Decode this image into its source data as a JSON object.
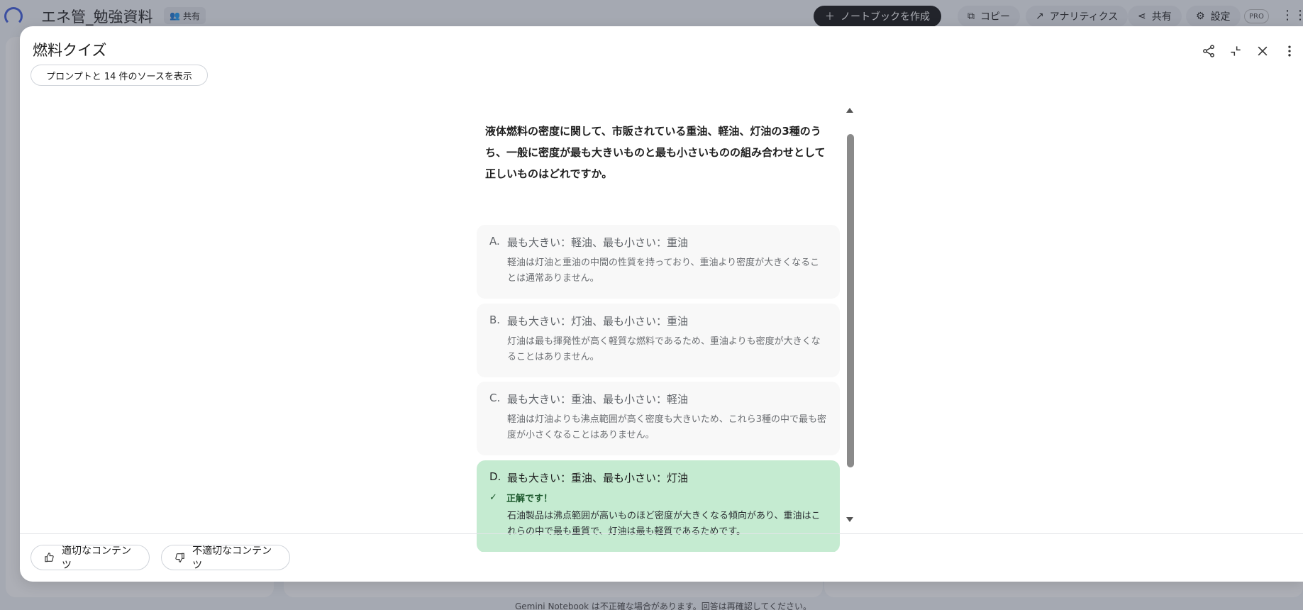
{
  "background": {
    "app_title": "エネ管_勉強資料",
    "share_chip": "共有",
    "create_notebook": "ノートブックを作成",
    "copy": "コピー",
    "analytics": "アナリティクス",
    "share": "共有",
    "settings": "設定",
    "pro_badge": "PRO",
    "footer_disclaimer": "Gemini Notebook は不正確な場合があります。回答は再確認してください。",
    "accent_color": "#111111"
  },
  "modal": {
    "title": "燃料クイズ",
    "source_chip": "プロンプトと 14 件のソースを表示",
    "actions": [
      "share-icon",
      "collapse-icon",
      "close-icon",
      "more-vert-icon"
    ]
  },
  "quiz": {
    "question": "液体燃料の密度に関して、市販されている重油、軽油、灯油の3種のうち、一般に密度が最も大きいものと最も小さいものの組み合わせとして正しいものはどれですか。",
    "options": [
      {
        "letter": "A.",
        "text": "最も大きい：軽油、最も小さい：重油",
        "explanation": "軽油は灯油と重油の中間の性質を持っており、重油より密度が大きくなることは通常ありません。"
      },
      {
        "letter": "B.",
        "text": "最も大きい：灯油、最も小さい：重油",
        "explanation": "灯油は最も揮発性が高く軽質な燃料であるため、重油よりも密度が大きくなることはありません。"
      },
      {
        "letter": "C.",
        "text": "最も大きい：重油、最も小さい：軽油",
        "explanation": "軽油は灯油よりも沸点範囲が高く密度も大きいため、これら3種の中で最も密度が小さくなることはありません。"
      },
      {
        "letter": "D.",
        "text": "最も大きい：重油、最も小さい：灯油",
        "correct_label": "正解です！",
        "explanation": "石油製品は沸点範囲が高いものほど密度が大きくなる傾向があり、重油はこれらの中で最も重質で、灯油は最も軽質であるためです。",
        "correct_color": "#c5ebd1"
      }
    ]
  },
  "footer": {
    "good_content": "適切なコンテンツ",
    "bad_content": "不適切なコンテンツ"
  }
}
